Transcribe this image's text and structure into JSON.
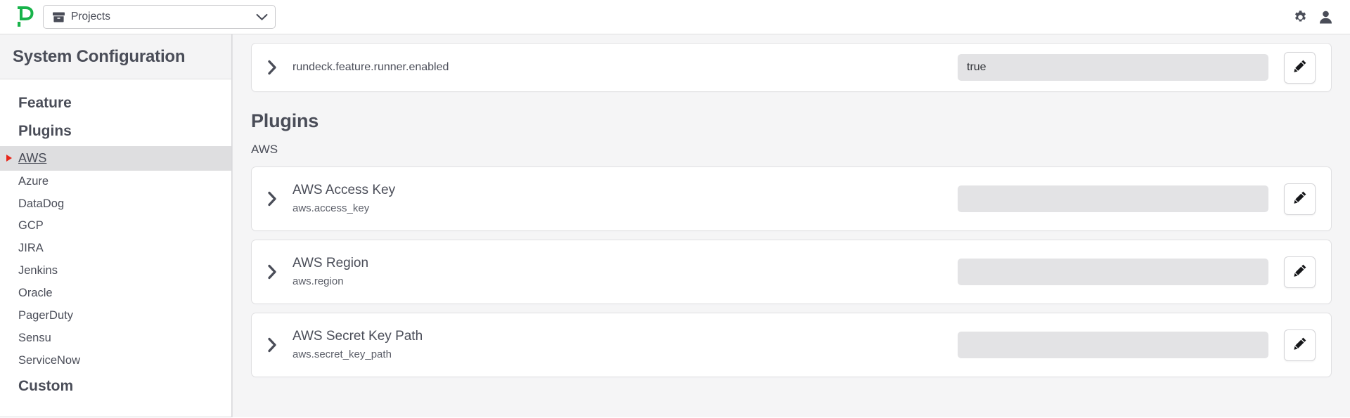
{
  "navbar": {
    "logo_icon": "rundeck-p-logo",
    "project_selector": {
      "icon": "box-archive-icon",
      "label": "Projects",
      "chevron_icon": "chevron-down-icon"
    },
    "icons": [
      {
        "name": "gear-icon",
        "label": "Settings"
      },
      {
        "name": "user-icon",
        "label": "Account"
      }
    ]
  },
  "sidebar": {
    "title": "System Configuration",
    "items": [
      {
        "label": "Feature",
        "type": "group",
        "active": false
      },
      {
        "label": "Plugins",
        "type": "group",
        "active": false
      },
      {
        "label": "AWS",
        "type": "item",
        "active": true
      },
      {
        "label": "Azure",
        "type": "item",
        "active": false
      },
      {
        "label": "DataDog",
        "type": "item",
        "active": false
      },
      {
        "label": "GCP",
        "type": "item",
        "active": false
      },
      {
        "label": "JIRA",
        "type": "item",
        "active": false
      },
      {
        "label": "Jenkins",
        "type": "item",
        "active": false
      },
      {
        "label": "Oracle",
        "type": "item",
        "active": false
      },
      {
        "label": "PagerDuty",
        "type": "item",
        "active": false
      },
      {
        "label": "Sensu",
        "type": "item",
        "active": false
      },
      {
        "label": "ServiceNow",
        "type": "item",
        "active": false
      },
      {
        "label": "Custom",
        "type": "group",
        "active": false
      }
    ],
    "active_marker_color": "#e8261a"
  },
  "main": {
    "feature_row": {
      "chevron_icon": "chevron-right-icon",
      "key": "rundeck.feature.runner.enabled",
      "value": "true",
      "edit_icon": "pencil-icon"
    },
    "plugins_heading": "Plugins",
    "plugins_group_label": "AWS",
    "plugin_rows": [
      {
        "chevron_icon": "chevron-right-icon",
        "title": "AWS Access Key",
        "key": "aws.access_key",
        "value": "",
        "edit_icon": "pencil-icon"
      },
      {
        "chevron_icon": "chevron-right-icon",
        "title": "AWS Region",
        "key": "aws.region",
        "value": "",
        "edit_icon": "pencil-icon"
      },
      {
        "chevron_icon": "chevron-right-icon",
        "title": "AWS Secret Key Path",
        "key": "aws.secret_key_path",
        "value": "",
        "edit_icon": "pencil-icon"
      }
    ]
  },
  "colors": {
    "logo_green": "#22b14c",
    "text_dark": "#4a4d58",
    "active_row_bg": "#dedee0",
    "input_bg": "#e3e3e5",
    "page_bg": "#f5f5f6"
  }
}
